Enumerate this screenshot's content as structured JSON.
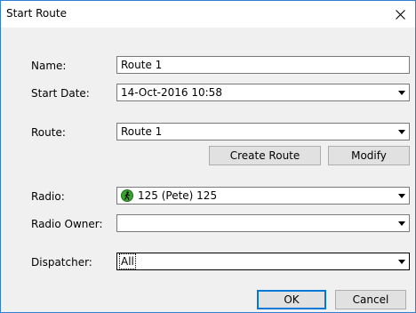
{
  "window": {
    "title": "Start Route"
  },
  "form": {
    "name": {
      "label": "Name:",
      "value": "Route 1"
    },
    "start_date": {
      "label": "Start Date:",
      "value": "14-Oct-2016 10:58"
    },
    "route": {
      "label": "Route:",
      "value": "Route 1"
    },
    "radio": {
      "label": "Radio:",
      "value": "125 (Pete) 125",
      "icon": "walking-person-icon",
      "icon_color": "#39a42b"
    },
    "radio_owner": {
      "label": "Radio Owner:",
      "value": ""
    },
    "dispatcher": {
      "label": "Dispatcher:",
      "value": "All"
    }
  },
  "buttons": {
    "create_route": "Create Route",
    "modify": "Modify",
    "ok": "OK",
    "cancel": "Cancel"
  },
  "colors": {
    "accent": "#0078d7",
    "window_border": "#2f7fd6",
    "background": "#f0f0f0"
  }
}
